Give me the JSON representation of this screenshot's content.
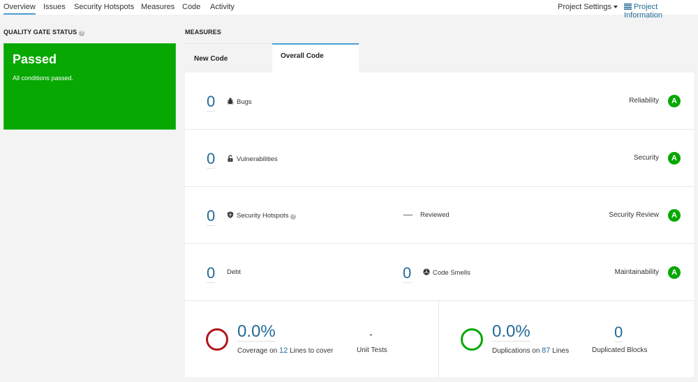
{
  "nav": {
    "tabs": [
      "Overview",
      "Issues",
      "Security Hotspots",
      "Measures",
      "Code",
      "Activity"
    ],
    "active_tab": "Overview",
    "project_settings": "Project Settings",
    "project_information": "Project Information"
  },
  "quality_gate": {
    "title": "QUALITY GATE STATUS",
    "status": "Passed",
    "message": "All conditions passed.",
    "color": "#06a801"
  },
  "measures": {
    "title": "MEASURES",
    "tabs": [
      "New Code",
      "Overall Code"
    ],
    "active_tab": "Overall Code",
    "rows": [
      {
        "value": "0",
        "label": "Bugs",
        "icon": "bug-icon",
        "rating_label": "Reliability",
        "rating": "A"
      },
      {
        "value": "0",
        "label": "Vulnerabilities",
        "icon": "lock-icon",
        "rating_label": "Security",
        "rating": "A"
      },
      {
        "value": "0",
        "label": "Security Hotspots",
        "icon": "shield-icon",
        "reviewed_value": "—",
        "reviewed_label": "Reviewed",
        "rating_label": "Security Review",
        "rating": "A"
      },
      {
        "value": "0",
        "label": "Debt",
        "smells_value": "0",
        "smells_label": "Code Smells",
        "icon": "code-smell-icon",
        "rating_label": "Maintainability",
        "rating": "A"
      }
    ],
    "coverage": {
      "value": "0.0%",
      "prefix": "Coverage on",
      "lines": "12",
      "suffix": "Lines to cover",
      "unit_tests_value": "-",
      "unit_tests_label": "Unit Tests",
      "color": "#b0161c"
    },
    "duplications": {
      "value": "0.0%",
      "prefix": "Duplications on",
      "lines": "87",
      "suffix": "Lines",
      "blocks_value": "0",
      "blocks_label": "Duplicated Blocks",
      "color": "#06a801"
    }
  }
}
